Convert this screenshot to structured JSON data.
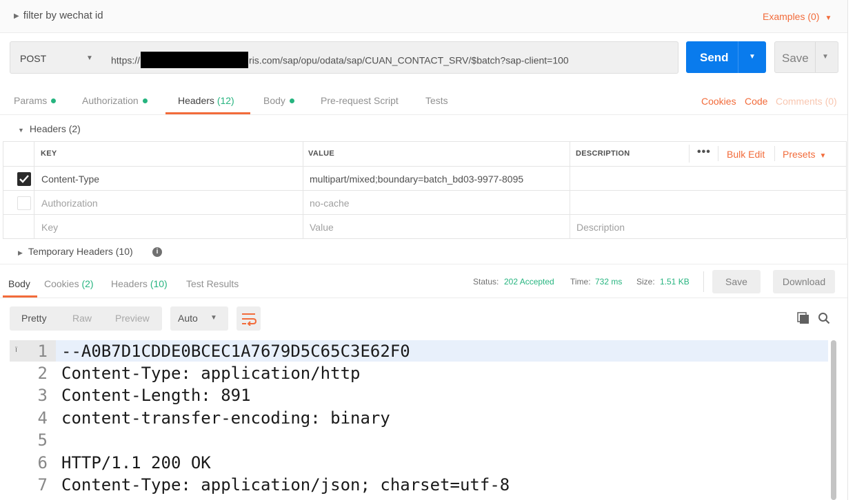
{
  "request": {
    "name": "filter by wechat id",
    "examples": "Examples (0)",
    "method": "POST",
    "url_prefix": "https://",
    "url_suffix": "ris.com/sap/opu/odata/sap/CUAN_CONTACT_SRV/$batch?sap-client=100",
    "send_label": "Send",
    "save_label": "Save"
  },
  "request_tabs": {
    "params": "Params",
    "authorization": "Authorization",
    "headers": "Headers",
    "headers_count": "(12)",
    "body": "Body",
    "prerequest": "Pre-request Script",
    "tests": "Tests",
    "cookies": "Cookies",
    "code": "Code",
    "comments": "Comments (0)"
  },
  "headers_section": {
    "title": "Headers",
    "count": "(2)",
    "columns": [
      "KEY",
      "VALUE",
      "DESCRIPTION"
    ],
    "bulk_edit": "Bulk Edit",
    "presets": "Presets",
    "rows": [
      {
        "key": "Content-Type",
        "value": "multipart/mixed;boundary=batch_bd03-9977-8095",
        "description": "",
        "checked": true
      },
      {
        "key": "Authorization",
        "value": "no-cache",
        "description": "",
        "checked": false
      }
    ],
    "placeholder": {
      "key": "Key",
      "value": "Value",
      "description": "Description"
    },
    "temporary_headers": "Temporary Headers",
    "temporary_count": "(10)"
  },
  "response": {
    "tabs": {
      "body": "Body",
      "cookies": "Cookies",
      "cookies_count": "(2)",
      "headers": "Headers",
      "headers_count": "(10)",
      "test_results": "Test Results"
    },
    "status_label": "Status:",
    "status_value": "202 Accepted",
    "time_label": "Time:",
    "time_value": "732 ms",
    "size_label": "Size:",
    "size_value": "1.51 KB",
    "save_label": "Save",
    "download_label": "Download",
    "view_modes": [
      "Pretty",
      "Raw",
      "Preview"
    ],
    "format": "Auto",
    "lines": [
      {
        "n": "1",
        "text": "--A0B7D1CDDE0BCEC1A7679D5C65C3E62F0"
      },
      {
        "n": "2",
        "text": "Content-Type: application/http"
      },
      {
        "n": "3",
        "text": "Content-Length: 891"
      },
      {
        "n": "4",
        "text": "content-transfer-encoding: binary"
      },
      {
        "n": "5",
        "text": ""
      },
      {
        "n": "6",
        "text": "HTTP/1.1 200 OK"
      },
      {
        "n": "7",
        "text": "Content-Type: application/json; charset=utf-8"
      }
    ]
  },
  "colors": {
    "accent": "#f26b3a",
    "send": "#097bed",
    "success": "#26b47f"
  }
}
